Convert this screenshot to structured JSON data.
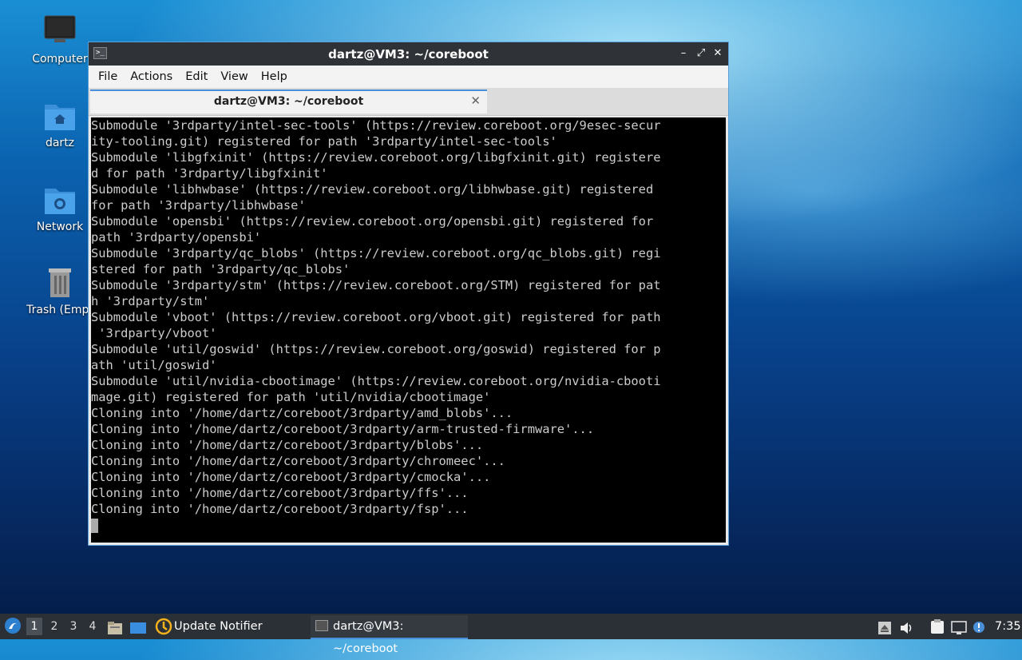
{
  "desktop": {
    "icons": [
      {
        "label": "Computer",
        "icon": "monitor-icon"
      },
      {
        "label": "dartz",
        "icon": "home-folder-icon"
      },
      {
        "label": "Network",
        "icon": "network-folder-icon"
      },
      {
        "label": "Trash (Empt",
        "icon": "trash-icon"
      }
    ]
  },
  "window": {
    "title": "dartz@VM3: ~/coreboot",
    "controls": {
      "minimize": "–",
      "maximize": "⤢",
      "close": "✕"
    },
    "menu": [
      "File",
      "Actions",
      "Edit",
      "View",
      "Help"
    ],
    "tab": {
      "label": "dartz@VM3: ~/coreboot",
      "close": "✕"
    },
    "terminal_lines": [
      "Submodule '3rdparty/intel-sec-tools' (https://review.coreboot.org/9esec-secur",
      "ity-tooling.git) registered for path '3rdparty/intel-sec-tools'",
      "Submodule 'libgfxinit' (https://review.coreboot.org/libgfxinit.git) registere",
      "d for path '3rdparty/libgfxinit'",
      "Submodule 'libhwbase' (https://review.coreboot.org/libhwbase.git) registered",
      "for path '3rdparty/libhwbase'",
      "Submodule 'opensbi' (https://review.coreboot.org/opensbi.git) registered for",
      "path '3rdparty/opensbi'",
      "Submodule '3rdparty/qc_blobs' (https://review.coreboot.org/qc_blobs.git) regi",
      "stered for path '3rdparty/qc_blobs'",
      "Submodule '3rdparty/stm' (https://review.coreboot.org/STM) registered for pat",
      "h '3rdparty/stm'",
      "Submodule 'vboot' (https://review.coreboot.org/vboot.git) registered for path",
      " '3rdparty/vboot'",
      "Submodule 'util/goswid' (https://review.coreboot.org/goswid) registered for p",
      "ath 'util/goswid'",
      "Submodule 'util/nvidia-cbootimage' (https://review.coreboot.org/nvidia-cbooti",
      "mage.git) registered for path 'util/nvidia/cbootimage'",
      "Cloning into '/home/dartz/coreboot/3rdparty/amd_blobs'...",
      "Cloning into '/home/dartz/coreboot/3rdparty/arm-trusted-firmware'...",
      "Cloning into '/home/dartz/coreboot/3rdparty/blobs'...",
      "Cloning into '/home/dartz/coreboot/3rdparty/chromeec'...",
      "Cloning into '/home/dartz/coreboot/3rdparty/cmocka'...",
      "Cloning into '/home/dartz/coreboot/3rdparty/ffs'...",
      "Cloning into '/home/dartz/coreboot/3rdparty/fsp'..."
    ]
  },
  "taskbar": {
    "workspaces": [
      "1",
      "2",
      "3",
      "4"
    ],
    "active_workspace": "1",
    "tasks": [
      {
        "label": "Update Notifier",
        "icon": "update-notifier-icon"
      },
      {
        "label": "dartz@VM3: ~/coreboot",
        "icon": "terminal-icon"
      }
    ],
    "clock": "7:35",
    "colors": {
      "accent": "#4a90d9",
      "panel": "#2b3036"
    }
  }
}
